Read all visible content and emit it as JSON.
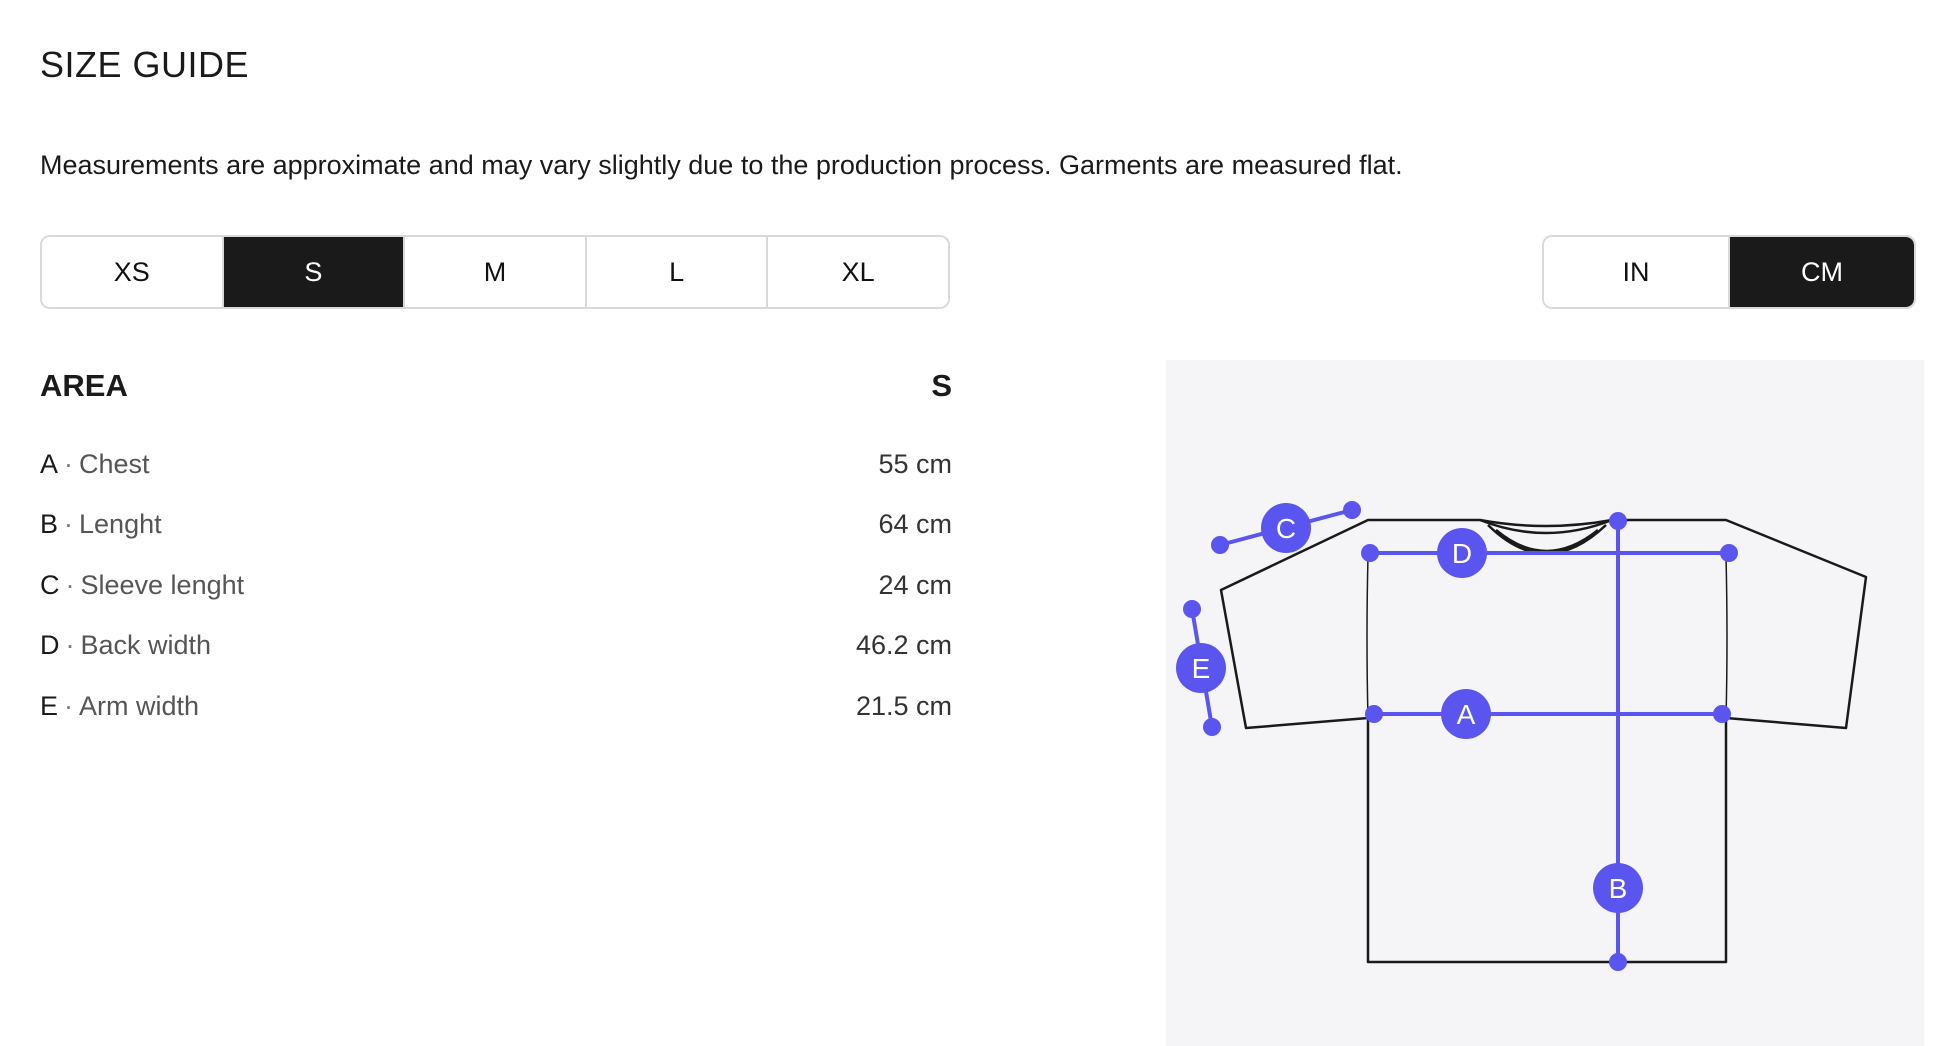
{
  "header": {
    "title": "SIZE GUIDE",
    "intro": "Measurements are approximate and may vary slightly due to the production process. Garments are measured flat."
  },
  "sizes": {
    "options": [
      "XS",
      "S",
      "M",
      "L",
      "XL"
    ],
    "selected": "S"
  },
  "units": {
    "options": [
      "IN",
      "CM"
    ],
    "selected": "CM"
  },
  "table": {
    "area_header": "AREA",
    "size_header": "S",
    "rows": [
      {
        "letter": "A",
        "area": "Chest",
        "value": "55 cm"
      },
      {
        "letter": "B",
        "area": "Lenght",
        "value": "64 cm"
      },
      {
        "letter": "C",
        "area": "Sleeve lenght",
        "value": "24 cm"
      },
      {
        "letter": "D",
        "area": "Back width",
        "value": "46.2 cm"
      },
      {
        "letter": "E",
        "area": "Arm width",
        "value": "21.5 cm"
      }
    ],
    "separator": "·"
  },
  "diagram": {
    "markers": [
      "A",
      "B",
      "C",
      "D",
      "E"
    ],
    "accent_color": "#5b55f0",
    "outline_color": "#1a1a1a"
  }
}
